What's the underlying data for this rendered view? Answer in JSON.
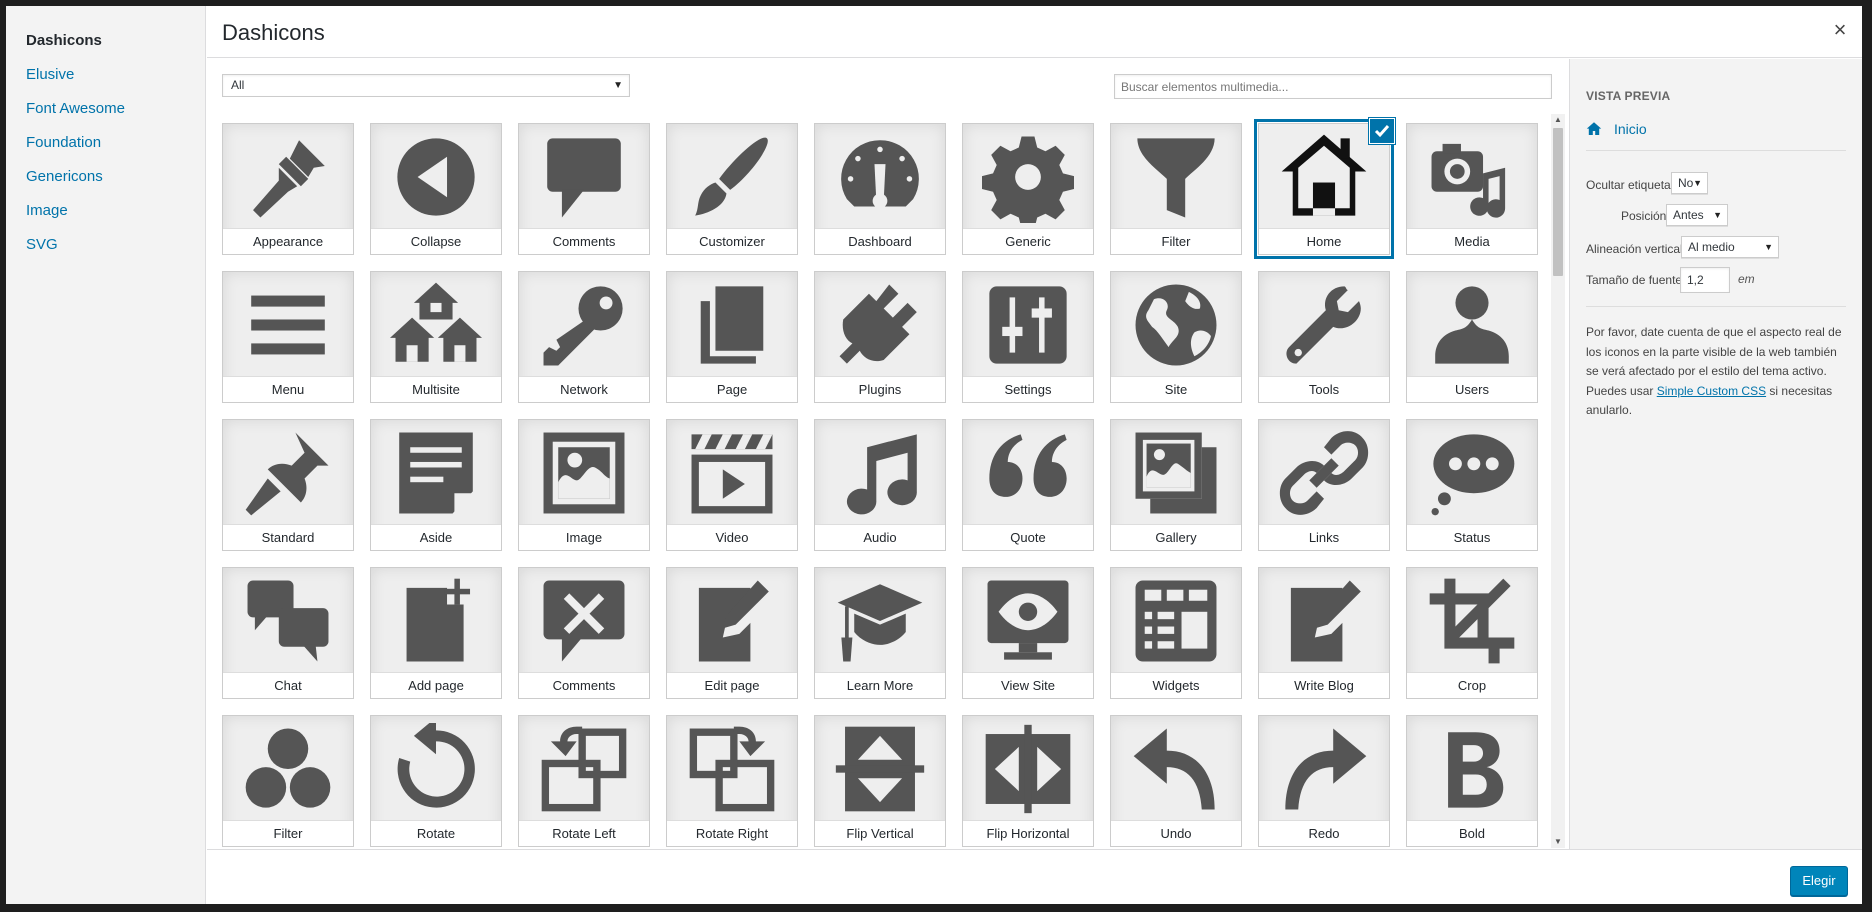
{
  "menu": {
    "items": [
      {
        "label": "Dashicons",
        "active": true
      },
      {
        "label": "Elusive"
      },
      {
        "label": "Font Awesome"
      },
      {
        "label": "Foundation"
      },
      {
        "label": "Genericons"
      },
      {
        "label": "Image"
      },
      {
        "label": "SVG"
      }
    ]
  },
  "header": {
    "title": "Dashicons",
    "close_symbol": "×"
  },
  "toolbar": {
    "filter_value": "All",
    "search_placeholder": "Buscar elementos multimedia..."
  },
  "icons": [
    {
      "label": "Appearance",
      "icon": "paintbrush-icon"
    },
    {
      "label": "Collapse",
      "icon": "collapse-icon"
    },
    {
      "label": "Comments",
      "icon": "comment-bubble-icon"
    },
    {
      "label": "Customizer",
      "icon": "brush-icon"
    },
    {
      "label": "Dashboard",
      "icon": "dashboard-gauge-icon"
    },
    {
      "label": "Generic",
      "icon": "gear-icon"
    },
    {
      "label": "Filter",
      "icon": "funnel-icon"
    },
    {
      "label": "Home",
      "icon": "home-icon",
      "selected": true
    },
    {
      "label": "Media",
      "icon": "camera-music-icon"
    },
    {
      "label": "Menu",
      "icon": "hamburger-menu-icon"
    },
    {
      "label": "Multisite",
      "icon": "multisite-houses-icon"
    },
    {
      "label": "Network",
      "icon": "key-icon"
    },
    {
      "label": "Page",
      "icon": "pages-icon"
    },
    {
      "label": "Plugins",
      "icon": "plug-icon"
    },
    {
      "label": "Settings",
      "icon": "sliders-icon"
    },
    {
      "label": "Site",
      "icon": "globe-icon"
    },
    {
      "label": "Tools",
      "icon": "wrench-icon"
    },
    {
      "label": "Users",
      "icon": "user-icon"
    },
    {
      "label": "Standard",
      "icon": "pushpin-icon"
    },
    {
      "label": "Aside",
      "icon": "aside-note-icon"
    },
    {
      "label": "Image",
      "icon": "image-icon"
    },
    {
      "label": "Video",
      "icon": "video-clapper-icon"
    },
    {
      "label": "Audio",
      "icon": "music-note-icon"
    },
    {
      "label": "Quote",
      "icon": "quote-icon"
    },
    {
      "label": "Gallery",
      "icon": "gallery-icon"
    },
    {
      "label": "Links",
      "icon": "chain-link-icon"
    },
    {
      "label": "Status",
      "icon": "status-bubble-icon"
    },
    {
      "label": "Chat",
      "icon": "chat-bubbles-icon"
    },
    {
      "label": "Add page",
      "icon": "add-page-icon"
    },
    {
      "label": "Comments",
      "icon": "no-comments-icon"
    },
    {
      "label": "Edit page",
      "icon": "edit-page-icon"
    },
    {
      "label": "Learn More",
      "icon": "graduation-cap-icon"
    },
    {
      "label": "View Site",
      "icon": "view-site-eye-icon"
    },
    {
      "label": "Widgets",
      "icon": "widgets-icon"
    },
    {
      "label": "Write Blog",
      "icon": "write-blog-icon"
    },
    {
      "label": "Crop",
      "icon": "crop-icon"
    },
    {
      "label": "Filter",
      "icon": "circles-filter-icon"
    },
    {
      "label": "Rotate",
      "icon": "rotate-icon"
    },
    {
      "label": "Rotate Left",
      "icon": "rotate-left-icon"
    },
    {
      "label": "Rotate Right",
      "icon": "rotate-right-icon"
    },
    {
      "label": "Flip Vertical",
      "icon": "flip-vertical-icon"
    },
    {
      "label": "Flip Horizontal",
      "icon": "flip-horizontal-icon"
    },
    {
      "label": "Undo",
      "icon": "undo-icon"
    },
    {
      "label": "Redo",
      "icon": "redo-icon"
    },
    {
      "label": "Bold",
      "icon": "bold-icon"
    }
  ],
  "sidebar": {
    "title": "Vista previa",
    "preview_label": "Inicio",
    "hide_label": {
      "label": "Ocultar etiqueta",
      "value": "No"
    },
    "position": {
      "label": "Posición",
      "value": "Antes"
    },
    "vertical_align": {
      "label": "Alineación vertical",
      "value": "Al medio"
    },
    "font_size": {
      "label": "Tamaño de fuente",
      "value": "1,2",
      "unit": "em"
    },
    "note_text": "Por favor, date cuenta de que el aspecto real de los iconos en la parte visible de la web también se verá afectado por el estilo del tema activo. Puedes usar ",
    "note_link": "Simple Custom CSS",
    "note_suffix": " si necesitas anularlo."
  },
  "footer": {
    "primary_button": "Elegir"
  },
  "colors": {
    "accent": "#0073aa",
    "button": "#0085ba",
    "icon": "#555555"
  }
}
